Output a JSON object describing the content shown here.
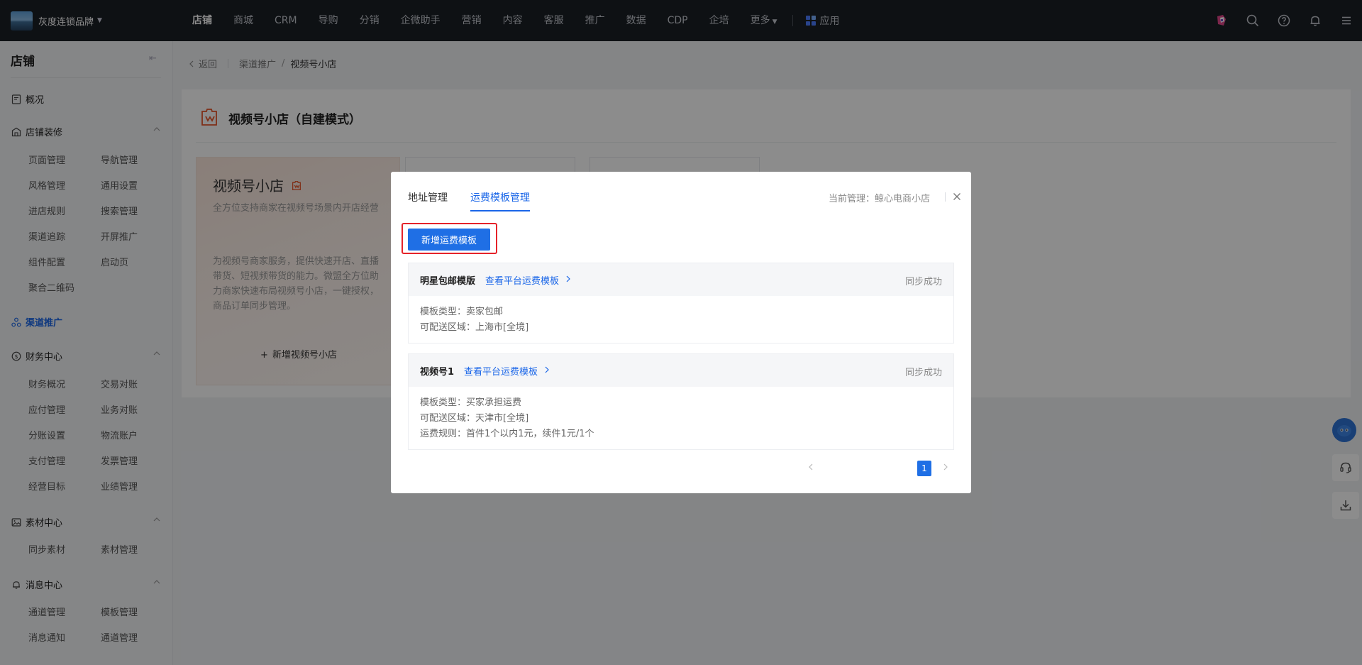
{
  "topbar": {
    "brand_name": "灰度连锁品牌",
    "nav": [
      "店铺",
      "商城",
      "CRM",
      "导购",
      "分销",
      "企微助手",
      "营销",
      "内容",
      "客服",
      "推广",
      "数据",
      "CDP",
      "企培",
      "更多"
    ],
    "active_nav": "店铺",
    "apps_label": "应用"
  },
  "sidebar": {
    "title": "店铺",
    "groups": [
      {
        "label": "概况",
        "icon": "overview-icon",
        "items": []
      },
      {
        "label": "店铺装修",
        "icon": "store-decoration-icon",
        "items": [
          "页面管理",
          "导航管理",
          "风格管理",
          "通用设置",
          "进店规则",
          "搜索管理",
          "渠道追踪",
          "开屏推广",
          "组件配置",
          "启动页",
          "聚合二维码"
        ]
      },
      {
        "label": "渠道推广",
        "icon": "channel-promotion-icon",
        "items": [],
        "active": true
      },
      {
        "label": "财务中心",
        "icon": "finance-icon",
        "items": [
          "财务概况",
          "交易对账",
          "应付管理",
          "业务对账",
          "分账设置",
          "物流账户",
          "支付管理",
          "发票管理",
          "经营目标",
          "业绩管理"
        ]
      },
      {
        "label": "素材中心",
        "icon": "material-icon",
        "items": [
          "同步素材",
          "素材管理"
        ]
      },
      {
        "label": "消息中心",
        "icon": "message-icon",
        "items": [
          "通道管理",
          "模板管理",
          "消息通知",
          "通道管理"
        ]
      }
    ]
  },
  "breadcrumb": {
    "back": "返回",
    "parent": "渠道推广",
    "separator": "/",
    "current": "视频号小店"
  },
  "page": {
    "title": "视频号小店（自建模式）",
    "card": {
      "title": "视频号小店",
      "subtitle": "全方位支持商家在视频号场景内开店经营",
      "description": "为视频号商家服务，提供快速开店、直播带货、短视频带货的能力。微盟全方位助力商家快速布局视频号小店，一键授权，商品订单同步管理。",
      "add_label": "新增视频号小店"
    }
  },
  "modal": {
    "tabs": [
      "地址管理",
      "运费模板管理"
    ],
    "active_tab": "运费模板管理",
    "current_mgmt": "当前管理：鲸心电商小店",
    "add_button": "新增运费模板",
    "templates": [
      {
        "name": "明星包邮模版",
        "link": "查看平台运费模板",
        "status": "同步成功",
        "rows": [
          "模板类型：卖家包邮",
          "可配送区域：上海市[全境]"
        ]
      },
      {
        "name": "视频号1",
        "link": "查看平台运费模板",
        "status": "同步成功",
        "rows": [
          "模板类型：买家承担运费",
          "可配送区域：天津市[全境]",
          "运费规则：首件1个以内1元，续件1元/1个"
        ]
      }
    ],
    "pagination": {
      "current_page": "1"
    }
  },
  "colors": {
    "primary": "#1f6fe5",
    "highlight": "#e5232a",
    "topbar": "#1b1f26"
  }
}
